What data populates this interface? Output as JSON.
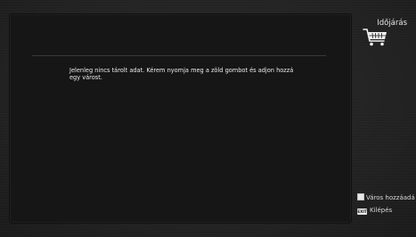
{
  "header": {
    "title": "Időjárás"
  },
  "main": {
    "message": "Jelenleg nincs tárolt adat. Kérem nyomja meg a zöld gombot és adjon hozzá egy várost."
  },
  "sidebar": {
    "icon": "shopping-cart-icon",
    "legend": {
      "green_label": "Város hozzáadá",
      "exit_key": "EXIT",
      "exit_label": "Kilépés"
    }
  },
  "colors": {
    "background": "#232323",
    "panel": "#161616",
    "text": "#ececec",
    "divider": "#3a3a3a"
  }
}
